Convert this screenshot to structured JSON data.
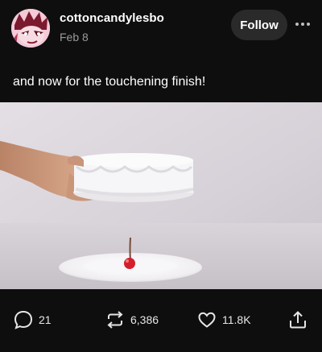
{
  "post": {
    "author": "cottoncandylesbo",
    "date": "Feb 8",
    "follow_label": "Follow",
    "caption": "and now for the touchening finish!",
    "media_description": "video still: hand holding white frosted cake above a plate with a single cherry",
    "counts": {
      "comments": "21",
      "reblogs": "6,386",
      "likes": "11.8K"
    }
  },
  "icons": {
    "avatar": "avatar-illustration",
    "more": "ellipsis-icon",
    "comment": "comment-bubble-icon",
    "reblog": "reblog-arrows-icon",
    "like": "heart-icon",
    "share": "share-upload-icon"
  },
  "colors": {
    "background": "#0e0e0e",
    "secondary_text": "#9a9a9a",
    "follow_button_bg": "#2a2a2a",
    "cherry": "#d51e2c"
  }
}
